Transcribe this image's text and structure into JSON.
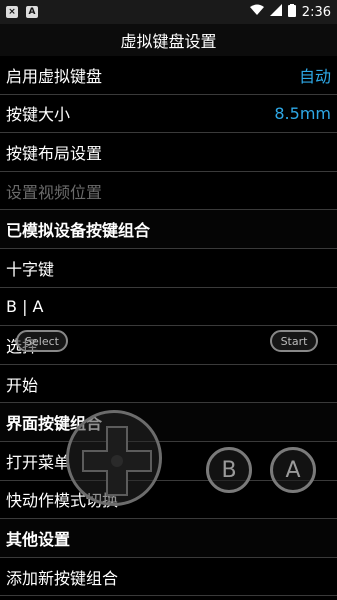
{
  "status": {
    "icon1": "×",
    "icon2": "A",
    "time": "2:36"
  },
  "title": "虚拟键盘设置",
  "rows": [
    {
      "label": "启用虚拟键盘",
      "value": "自动"
    },
    {
      "label": "按键大小",
      "value": "8.5mm"
    },
    {
      "label": "按键布局设置"
    },
    {
      "label": "设置视频位置"
    },
    {
      "label": "已模拟设备按键组合"
    },
    {
      "label": "十字键"
    },
    {
      "label": "B | A"
    },
    {
      "label": "选择"
    },
    {
      "label": "开始"
    },
    {
      "label": "界面按键组合"
    },
    {
      "label": "打开菜单"
    },
    {
      "label": "快动作模式切换"
    },
    {
      "label": "其他设置"
    },
    {
      "label": "添加新按键组合"
    }
  ],
  "overlay": {
    "select_label": "Select",
    "start_label": "Start",
    "b_label": "B",
    "a_label": "A"
  },
  "colors": {
    "accent": "#2ea8e6"
  }
}
